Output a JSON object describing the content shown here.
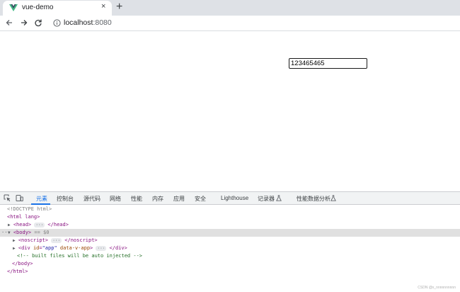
{
  "browser": {
    "tab_title": "vue-demo",
    "tab_close_glyph": "×",
    "new_tab_glyph": "+",
    "favicon": "vue-logo-icon",
    "address_host": "localhost",
    "address_port": ":8080"
  },
  "page": {
    "input_value": "123465465"
  },
  "devtools": {
    "tabs": [
      "元素",
      "控制台",
      "源代码",
      "网络",
      "性能",
      "内存",
      "应用",
      "安全",
      "Lighthouse",
      "记录器",
      "性能数据分析"
    ],
    "active_tab": "元素",
    "dom": {
      "doctype": "<!DOCTYPE html>",
      "html_open": "<html lang>",
      "head": "<head>",
      "head_close": "</head>",
      "body_open": "<body>",
      "selected_marker": "== $0",
      "noscript_open": "<noscript>",
      "noscript_close": "</noscript>",
      "div_tag": "div",
      "div_attr_id_name": "id",
      "div_attr_id_val": "\"app\"",
      "div_attr_data": "data-v-app",
      "div_close": "</div>",
      "comment": "<!-- built files will be auto injected -->",
      "body_close": "</body>",
      "html_close": "</html>",
      "ellipsis": "···"
    }
  },
  "watermark": "CSDN @x_nnnnnnnnnn",
  "colors": {
    "active_tab": "#1a73e8",
    "tag": "#881280",
    "attr_name": "#994500",
    "attr_value": "#1a1aa6",
    "comment": "#236e25",
    "vue_green": "#41b883"
  }
}
